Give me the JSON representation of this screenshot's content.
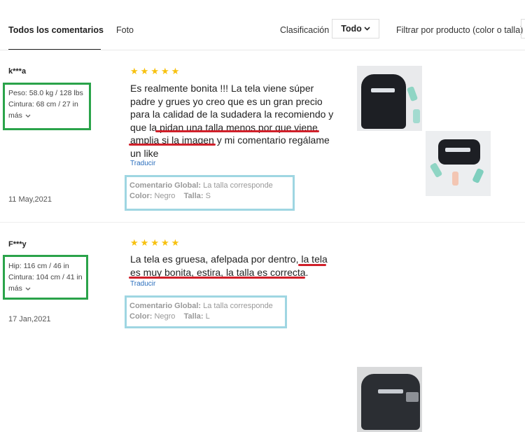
{
  "tabs": {
    "all": "Todos los comentarios",
    "photo": "Foto"
  },
  "sort": {
    "label": "Clasificación",
    "value": "Todo"
  },
  "filter": {
    "label": "Filtrar por producto (color o talla)"
  },
  "reviews": [
    {
      "user": "k***a",
      "size_lines": [
        "Peso: 58.0 kg / 128 lbs",
        "Cintura: 68 cm / 27 in",
        "más"
      ],
      "date": "11 May,2021",
      "rating": 5,
      "text_lines": [
        "Es realmente bonita !!! La tela viene súper",
        "padre y grues yo creo que es un gran precio",
        "para la calidad de la sudadera la recomiendo y",
        "que la pidan una talla menos por que viene",
        "amplia si la imagen y mi comentario regálame",
        "un like"
      ],
      "translate": "Traducir",
      "overall_label": "Comentario Global:",
      "overall_value": "La talla corresponde",
      "color_label": "Color:",
      "color_value": "Negro",
      "size_label": "Talla:",
      "size_value": "S"
    },
    {
      "user": "F***y",
      "size_lines": [
        "Hip: 116 cm / 46 in",
        "Cintura: 104 cm / 41 in",
        "más"
      ],
      "date": "17 Jan,2021",
      "rating": 5,
      "text_lines": [
        "La tela es gruesa, afelpada por dentro, la tela",
        "es muy bonita, estira, la talla es correcta."
      ],
      "translate": "Traducir",
      "overall_label": "Comentario Global:",
      "overall_value": "La talla corresponde",
      "color_label": "Color:",
      "color_value": "Negro",
      "size_label": "Talla:",
      "size_value": "L"
    }
  ],
  "icons": {
    "star": "star-icon",
    "chevron": "chevron-down-icon"
  },
  "colors": {
    "star": "#f7c10f",
    "underline": "#d0202a",
    "highlight_green": "#2aa34a",
    "highlight_blue": "#9fd6e2",
    "link": "#2a6ebd"
  }
}
